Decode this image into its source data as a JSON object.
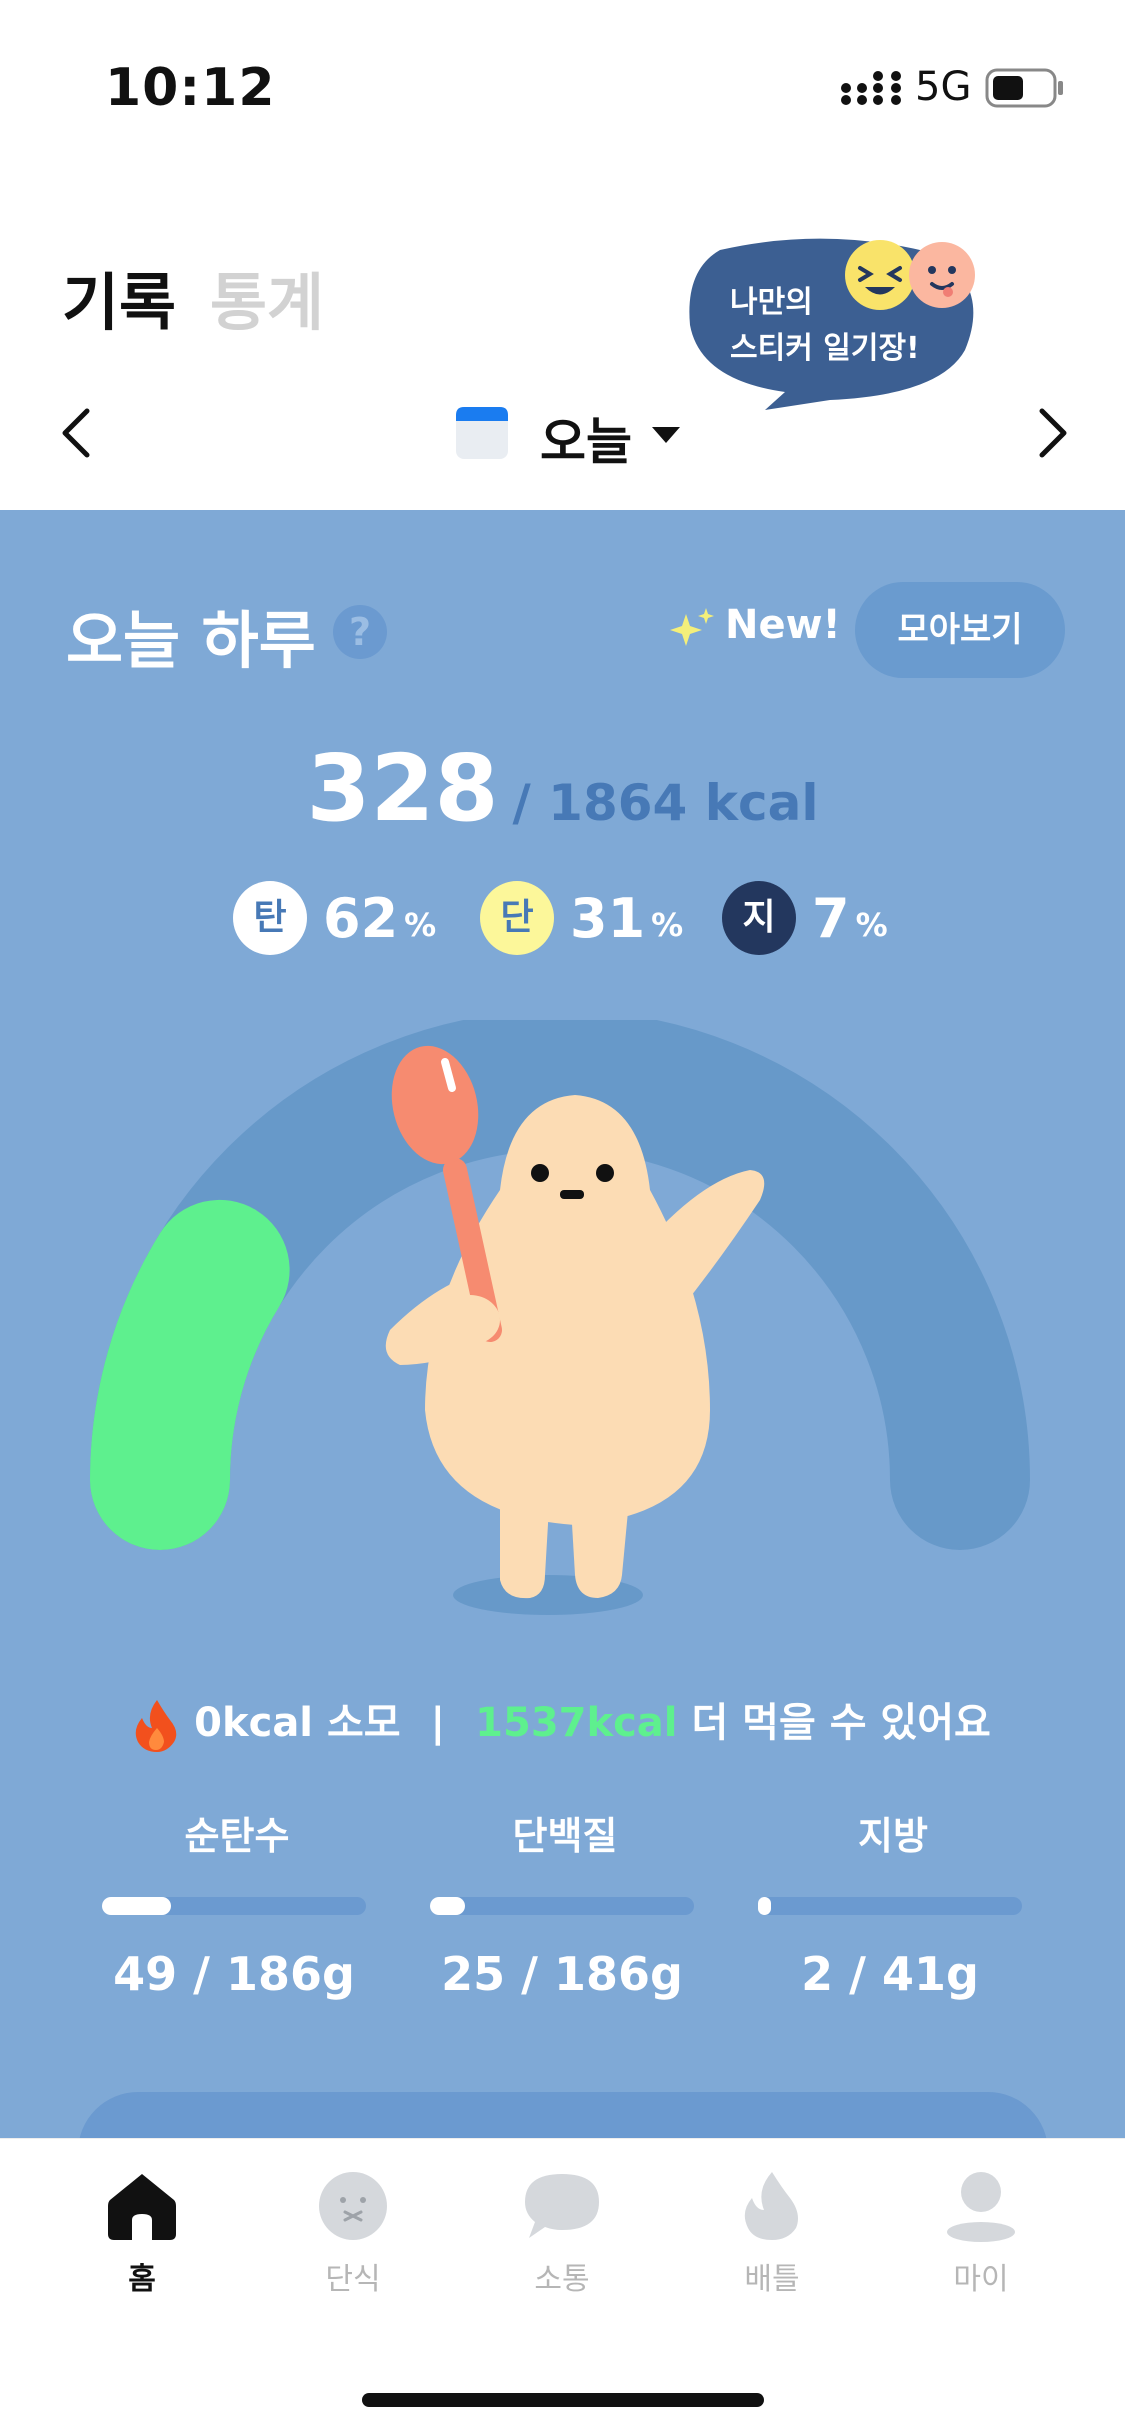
{
  "status_bar": {
    "time": "10:12",
    "network": "5G"
  },
  "header": {
    "tabs": [
      {
        "label": "기록",
        "active": true
      },
      {
        "label": "통계",
        "active": false
      }
    ],
    "sticker_bubble": {
      "line1": "나만의",
      "line2": "스티커 일기장!",
      "color": "#3c5f92"
    }
  },
  "date_nav": {
    "label": "오늘",
    "calendar_icon": "calendar-icon",
    "prev_icon": "chevron-left-icon",
    "next_icon": "chevron-right-icon"
  },
  "day_summary": {
    "title": "오늘 하루",
    "help_icon": "?",
    "new_label": "New!",
    "collection_button": "모아보기",
    "kcal_current": "328",
    "kcal_goal": "/ 1864 kcal",
    "macros": [
      {
        "abbr": "탄",
        "value": "62",
        "unit": "%",
        "circle_color": "#ffffff",
        "text_color": "#4779b6"
      },
      {
        "abbr": "단",
        "value": "31",
        "unit": "%",
        "circle_color": "#fcf79a",
        "text_color": "#4779b6"
      },
      {
        "abbr": "지",
        "value": "7",
        "unit": "%",
        "circle_color": "#23375e",
        "text_color": "#ffffff"
      }
    ],
    "gauge_progress": 0.176,
    "burned": "0kcal 소모",
    "separator": "|",
    "remaining_kcal": "1537kcal",
    "remaining_text": "더 먹을 수 있어요",
    "nutrients": [
      {
        "label": "순탄수",
        "amount": "49 / 186g",
        "progress": 0.263
      },
      {
        "label": "단백질",
        "amount": "25 / 186g",
        "progress": 0.134
      },
      {
        "label": "지방",
        "amount": "2 / 41g",
        "progress": 0.049
      }
    ]
  },
  "colors": {
    "panel_bg": "#7fa9d6",
    "gauge_track": "#6799c9",
    "gauge_fill": "#5ef08e",
    "accent_green": "#5ef08e"
  },
  "bottom_nav": [
    {
      "label": "홈",
      "icon": "home-icon",
      "active": true
    },
    {
      "label": "단식",
      "icon": "fasting-face-icon",
      "active": false
    },
    {
      "label": "소통",
      "icon": "chat-bubble-icon",
      "active": false
    },
    {
      "label": "배틀",
      "icon": "flame-icon",
      "active": false
    },
    {
      "label": "마이",
      "icon": "profile-icon",
      "active": false
    }
  ]
}
